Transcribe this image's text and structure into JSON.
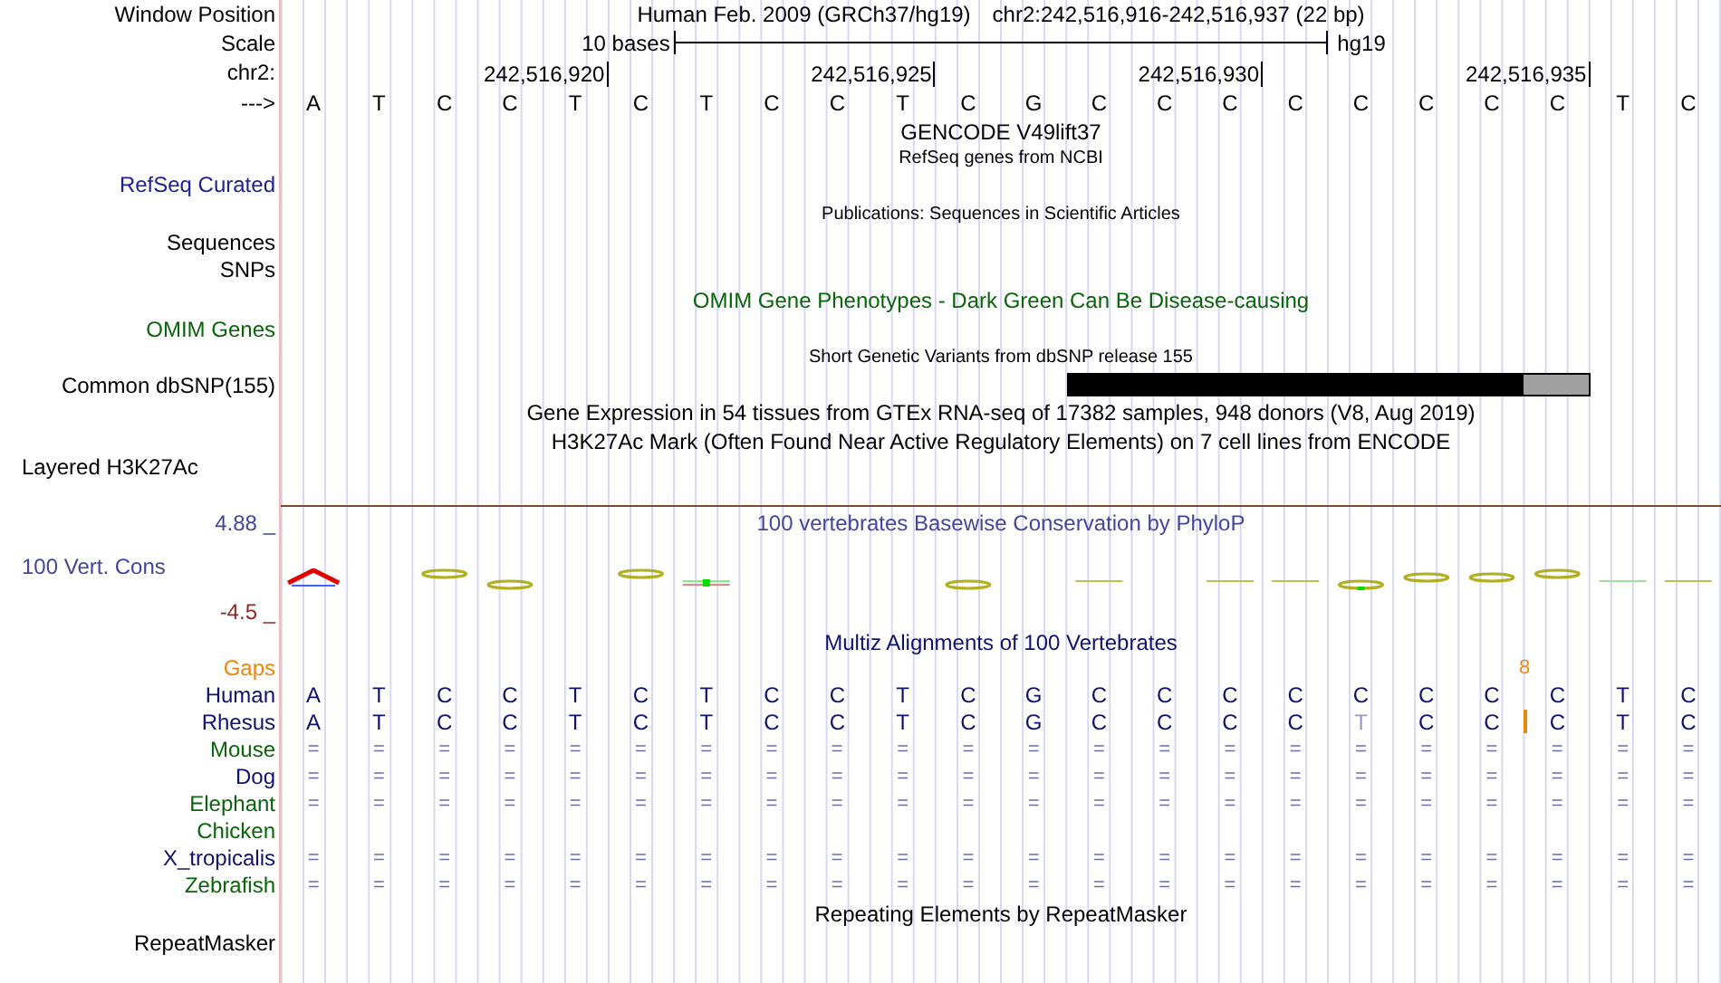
{
  "rows": [
    {
      "kind": "header",
      "label": "Window Position",
      "assembly": "Human Feb. 2009 (GRCh37/hg19)",
      "position": "chr2:242,516,916-242,516,937 (22 bp)"
    },
    {
      "kind": "scale",
      "label": "Scale",
      "length": "10 bases",
      "assembly": "hg19"
    },
    {
      "kind": "ruler",
      "label": "chr2:",
      "ticks": [
        "242,516,920",
        "242,516,925",
        "242,516,930",
        "242,516,935"
      ]
    },
    {
      "kind": "sequence",
      "label": "--->",
      "bases": [
        "A",
        "T",
        "C",
        "C",
        "T",
        "C",
        "T",
        "C",
        "C",
        "T",
        "C",
        "G",
        "C",
        "C",
        "C",
        "C",
        "C",
        "C",
        "C",
        "C",
        "T",
        "C"
      ]
    },
    {
      "kind": "title",
      "text": "GENCODE V49lift37"
    },
    {
      "kind": "subtitle",
      "text": "RefSeq genes from NCBI"
    },
    {
      "kind": "label",
      "label": "RefSeq Curated",
      "color": "#20208f"
    },
    {
      "kind": "subtitle",
      "text": "Publications: Sequences in Scientific Articles"
    },
    {
      "kind": "label",
      "label": "Sequences"
    },
    {
      "kind": "label",
      "label": "SNPs"
    },
    {
      "kind": "title",
      "text": "OMIM Gene Phenotypes - Dark Green Can Be Disease-causing",
      "color": "#0a640a"
    },
    {
      "kind": "label",
      "label": "OMIM Genes",
      "color": "#0a640a"
    },
    {
      "kind": "subtitle",
      "text": "Short Genetic Variants from dbSNP release 155"
    },
    {
      "kind": "variants",
      "label": "Common dbSNP(155)"
    },
    {
      "kind": "title",
      "text": "Gene Expression in 54 tissues from GTEx RNA-seq of 17382 samples, 948 donors (V8, Aug 2019)"
    },
    {
      "kind": "title",
      "text": "H3K27Ac Mark (Often Found Near Active Regulatory Elements) on 7 cell lines from ENCODE"
    },
    {
      "kind": "side-label",
      "label": "Layered H3K27Ac"
    },
    {
      "kind": "divider"
    },
    {
      "kind": "axis",
      "label": "4.88 _",
      "text": "100 vertebrates Basewise Conservation by PhyloP",
      "color": "#45459a"
    },
    {
      "kind": "wiggle",
      "label": "100 Vert. Cons",
      "color": "#45459a"
    },
    {
      "kind": "axis",
      "label": "-4.5 _",
      "color": "#8a2a2a"
    },
    {
      "kind": "title",
      "text": "Multiz Alignments of 100 Vertebrates",
      "color": "#101070"
    },
    {
      "kind": "gaps",
      "label": "Gaps",
      "count": "8",
      "color": "#e8880a"
    },
    {
      "kind": "alignment",
      "label": "Human",
      "color": "#101070",
      "bases": [
        "A",
        "T",
        "C",
        "C",
        "T",
        "C",
        "T",
        "C",
        "C",
        "T",
        "C",
        "G",
        "C",
        "C",
        "C",
        "C",
        "C",
        "C",
        "C",
        "C",
        "T",
        "C"
      ]
    },
    {
      "kind": "alignment",
      "label": "Rhesus",
      "color": "#101070",
      "bases": [
        {
          "base": "A",
          "faded": false,
          "insertion": false
        },
        {
          "base": "T",
          "faded": false,
          "insertion": false
        },
        {
          "base": "C",
          "faded": false,
          "insertion": false
        },
        {
          "base": "C",
          "faded": false,
          "insertion": false
        },
        {
          "base": "T",
          "faded": false,
          "insertion": false
        },
        {
          "base": "C",
          "faded": false,
          "insertion": false
        },
        {
          "base": "T",
          "faded": false,
          "insertion": false
        },
        {
          "base": "C",
          "faded": false,
          "insertion": false
        },
        {
          "base": "C",
          "faded": false,
          "insertion": false
        },
        {
          "base": "T",
          "faded": false,
          "insertion": false
        },
        {
          "base": "C",
          "faded": false,
          "insertion": false
        },
        {
          "base": "G",
          "faded": false,
          "insertion": false
        },
        {
          "base": "C",
          "faded": false,
          "insertion": false
        },
        {
          "base": "C",
          "faded": false,
          "insertion": false
        },
        {
          "base": "C",
          "faded": false,
          "insertion": false
        },
        {
          "base": "C",
          "faded": false,
          "insertion": false
        },
        {
          "base": "T",
          "faded": true,
          "insertion": false
        },
        {
          "base": "C",
          "faded": false,
          "insertion": false
        },
        {
          "base": "C",
          "faded": false,
          "insertion": true
        },
        {
          "base": "C",
          "faded": false,
          "insertion": false
        },
        {
          "base": "T",
          "faded": false,
          "insertion": false
        },
        {
          "base": "C",
          "faded": false,
          "insertion": false
        }
      ]
    },
    {
      "kind": "alignment",
      "label": "Mouse",
      "color": "#0a640a",
      "bases": [
        "=",
        "=",
        "=",
        "=",
        "=",
        "=",
        "=",
        "=",
        "=",
        "=",
        "=",
        "=",
        "=",
        "=",
        "=",
        "=",
        "=",
        "=",
        "=",
        "=",
        "=",
        "="
      ]
    },
    {
      "kind": "alignment",
      "label": "Dog",
      "color": "#101070",
      "bases": [
        "=",
        "=",
        "=",
        "=",
        "=",
        "=",
        "=",
        "=",
        "=",
        "=",
        "=",
        "=",
        "=",
        "=",
        "=",
        "=",
        "=",
        "=",
        "=",
        "=",
        "=",
        "="
      ]
    },
    {
      "kind": "alignment",
      "label": "Elephant",
      "color": "#0a640a",
      "bases": [
        "=",
        "=",
        "=",
        "=",
        "=",
        "=",
        "=",
        "=",
        "=",
        "=",
        "=",
        "=",
        "=",
        "=",
        "=",
        "=",
        "=",
        "=",
        "=",
        "=",
        "=",
        "="
      ]
    },
    {
      "kind": "alignment",
      "label": "Chicken",
      "color": "#0a640a"
    },
    {
      "kind": "alignment",
      "label": "X_tropicalis",
      "color": "#101070",
      "bases": [
        "=",
        "=",
        "=",
        "=",
        "=",
        "=",
        "=",
        "=",
        "=",
        "=",
        "=",
        "=",
        "=",
        "=",
        "=",
        "=",
        "=",
        "=",
        "=",
        "=",
        "=",
        "="
      ]
    },
    {
      "kind": "alignment",
      "label": "Zebrafish",
      "color": "#0a640a",
      "bases": [
        "=",
        "=",
        "=",
        "=",
        "=",
        "=",
        "=",
        "=",
        "=",
        "=",
        "=",
        "=",
        "=",
        "=",
        "=",
        "=",
        "=",
        "=",
        "=",
        "=",
        "=",
        "="
      ]
    },
    {
      "kind": "title",
      "text": "Repeating Elements by RepeatMasker"
    },
    {
      "kind": "label",
      "label": "RepeatMasker"
    }
  ]
}
